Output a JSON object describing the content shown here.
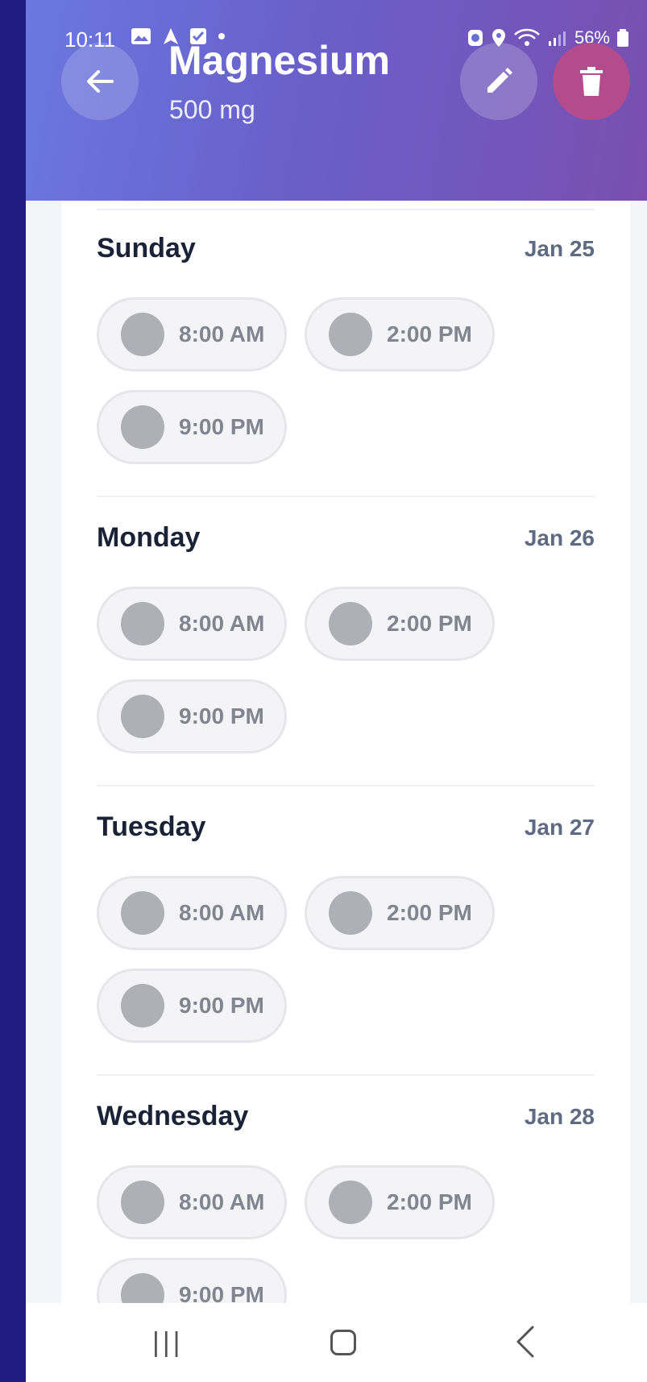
{
  "status": {
    "time": "10:11",
    "battery": "56%"
  },
  "header": {
    "title": "Magnesium",
    "dose": "500 mg"
  },
  "days": [
    {
      "name": "Sunday",
      "date": "Jan 25",
      "times": [
        "8:00 AM",
        "2:00 PM",
        "9:00 PM"
      ]
    },
    {
      "name": "Monday",
      "date": "Jan 26",
      "times": [
        "8:00 AM",
        "2:00 PM",
        "9:00 PM"
      ]
    },
    {
      "name": "Tuesday",
      "date": "Jan 27",
      "times": [
        "8:00 AM",
        "2:00 PM",
        "9:00 PM"
      ]
    },
    {
      "name": "Wednesday",
      "date": "Jan 28",
      "times": [
        "8:00 AM",
        "2:00 PM",
        "9:00 PM"
      ]
    }
  ],
  "colors": {
    "header_start": "#6a78e0",
    "header_end": "#7a4fb0",
    "delete_button": "#b34b8c",
    "dot_unchecked": "#aeb0b5"
  }
}
